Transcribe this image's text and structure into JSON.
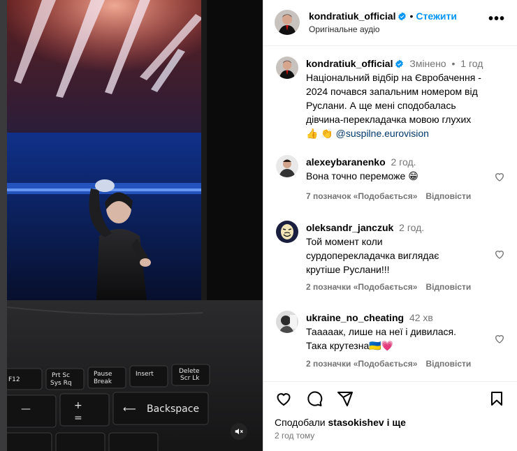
{
  "post": {
    "username": "kondratiuk_official",
    "follow_label": "Стежити",
    "audio_label": "Оригінальне аудіо",
    "more_label": "•••"
  },
  "caption": {
    "username": "kondratiuk_official",
    "edited_label": "Змінено",
    "separator": "•",
    "time": "1 год",
    "text_line1": "Національний відбір на Євробачення -",
    "text_line2": "2024 почався запальним номером від",
    "text_line3": "Руслани. А ще мені сподобалась",
    "text_line4": "дівчина-перекладачка мовою глухих",
    "emoji": "👍 👏",
    "mention": "@suspilne.eurovision"
  },
  "comments": [
    {
      "username": "alexeybaranenko",
      "time": "2 год.",
      "text_lines": [
        "Вона точно переможе 😁"
      ],
      "likes": "7 позначок «Подобається»",
      "reply": "Відповісти"
    },
    {
      "username": "oleksandr_janczuk",
      "time": "2 год.",
      "text_lines": [
        "Той момент коли",
        "сурдоперекладачка виглядає",
        "крутіше Руслани!!!"
      ],
      "likes": "2 позначки «Подобається»",
      "reply": "Відповісти"
    },
    {
      "username": "ukraine_no_cheating",
      "time": "42 хв",
      "text_lines": [
        "Таааaак, лише на неї і дивилася.",
        "Така крутезна🇺🇦💗"
      ],
      "likes": "2 позначки «Подобається»",
      "reply": "Відповісти"
    }
  ],
  "footer": {
    "liked_prefix": "Сподобали",
    "liked_user": "stasokishev",
    "liked_suffix": "і ще",
    "time_ago": "2 год тому"
  },
  "keyboard": {
    "keys": [
      "F12",
      "Prt Sc",
      "Sys Rq",
      "Pause",
      "Break",
      "Insert",
      "Delete",
      "Scr Lk",
      "+",
      "=",
      "Backspace"
    ]
  },
  "colors": {
    "accent": "#0095f6",
    "verified": "#0095f6",
    "muted_text": "#737373",
    "mention": "#00376b"
  },
  "icons": [
    "mute-icon",
    "verified-icon",
    "more-icon",
    "heart-icon",
    "comment-icon",
    "share-icon",
    "bookmark-icon"
  ]
}
